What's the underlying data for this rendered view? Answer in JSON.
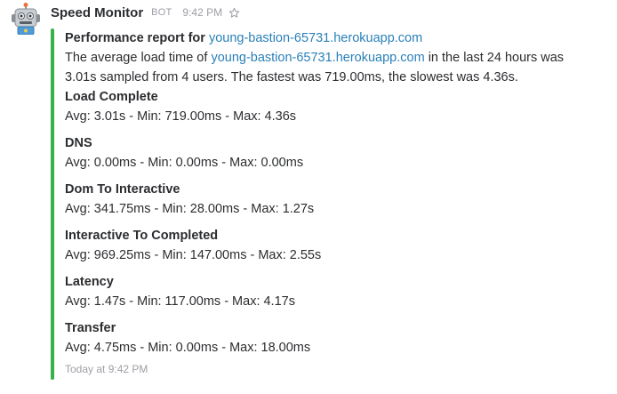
{
  "message": {
    "sender": "Speed Monitor",
    "bot_tag": "BOT",
    "time": "9:42 PM",
    "avatar_icon": "robot-icon",
    "star_icon": "star-outline-icon"
  },
  "attachment": {
    "accent_color": "#36b24b",
    "title_prefix": "Performance report for",
    "title_link": "young-bastion-65731.herokuapp.com",
    "summary_prefix": "The average load time of",
    "summary_link": "young-bastion-65731.herokuapp.com",
    "summary_suffix": "in the last 24 hours was 3.01s sampled from 4 users. The fastest was 719.00ms, the slowest was 4.36s.",
    "metrics": [
      {
        "name": "Load Complete",
        "value": "Avg: 3.01s - Min: 719.00ms - Max: 4.36s"
      },
      {
        "name": "DNS",
        "value": "Avg: 0.00ms - Min: 0.00ms - Max: 0.00ms"
      },
      {
        "name": "Dom To Interactive",
        "value": "Avg: 341.75ms - Min: 28.00ms - Max: 1.27s"
      },
      {
        "name": "Interactive To Completed",
        "value": "Avg: 969.25ms - Min: 147.00ms - Max: 2.55s"
      },
      {
        "name": "Latency",
        "value": "Avg: 1.47s - Min: 117.00ms - Max: 4.17s"
      },
      {
        "name": "Transfer",
        "value": "Avg: 4.75ms - Min: 0.00ms - Max: 18.00ms"
      }
    ],
    "footer": "Today at 9:42 PM"
  }
}
